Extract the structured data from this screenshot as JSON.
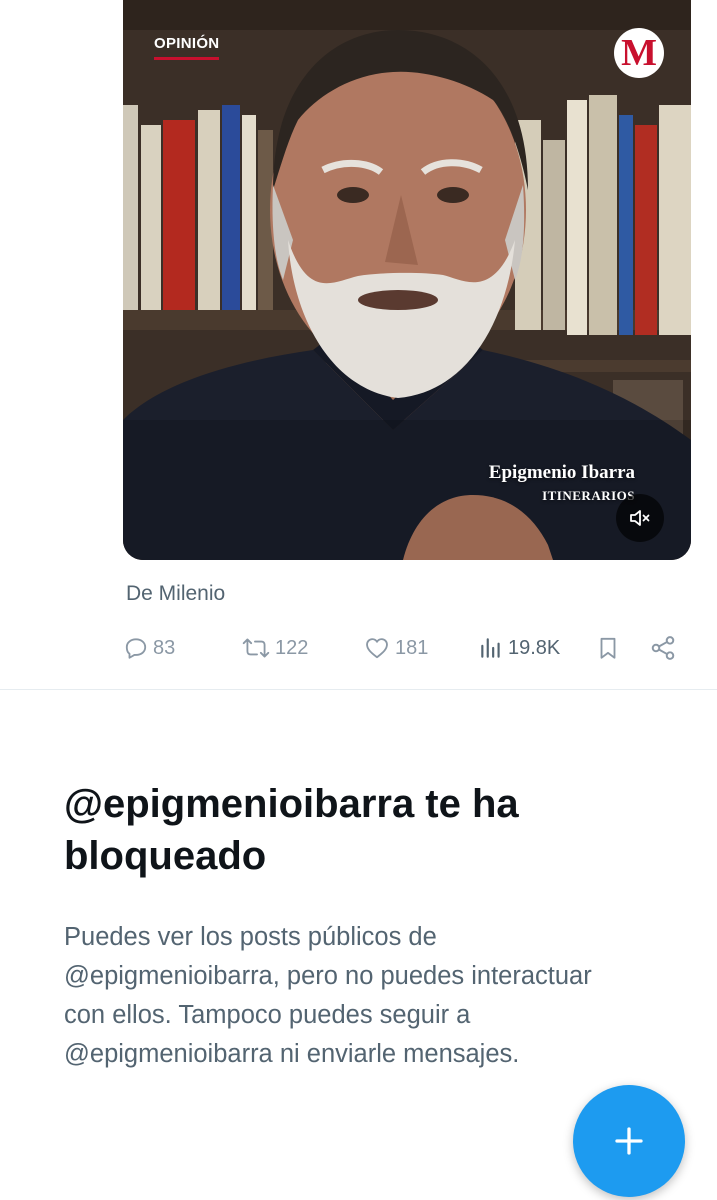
{
  "post": {
    "media": {
      "badge": "OPINIÓN",
      "logo_letter": "M",
      "caption_name": "Epigmenio Ibarra",
      "caption_show": "ITINERARIOS",
      "mute_icon": "speaker-muted-icon",
      "colors": {
        "badge_underline": "#c8102e",
        "logo_red": "#c8102e"
      }
    },
    "source": "De Milenio",
    "actions": {
      "replies": "83",
      "reposts": "122",
      "likes": "181",
      "views": "19.8K"
    }
  },
  "blocked": {
    "title": "@epigmenioibarra te ha bloqueado",
    "description": "Puedes ver los posts públicos de @epigmenioibarra, pero no puedes interactuar con ellos. Tampoco puedes seguir a @epigmenioibarra ni enviarle mensajes."
  },
  "fab": {
    "icon": "plus-icon",
    "color": "#1d9bf0"
  }
}
